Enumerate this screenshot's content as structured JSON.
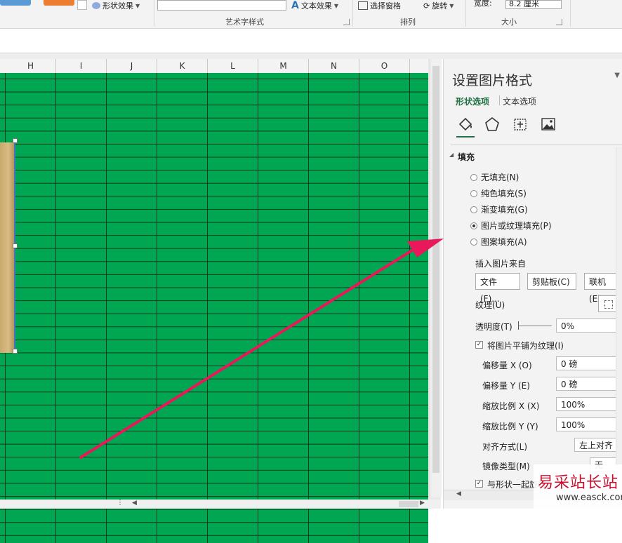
{
  "ribbon": {
    "shape_effect": "形状效果",
    "text_effect": "文本效果",
    "select_pane": "选择窗格",
    "rotate": "旋转",
    "width_label": "宽度:",
    "width_value": "8.2 厘米",
    "group_wordart": "艺术字样式",
    "group_arrange": "排列",
    "group_size": "大小"
  },
  "columns": [
    "H",
    "I",
    "J",
    "K",
    "L",
    "M",
    "N",
    "O"
  ],
  "pane": {
    "title": "设置图片格式",
    "tab_shape": "形状选项",
    "tab_text": "文本选项",
    "section_fill": "填充",
    "fill_options": [
      {
        "label": "无填充(N)",
        "selected": false
      },
      {
        "label": "纯色填充(S)",
        "selected": false
      },
      {
        "label": "渐变填充(G)",
        "selected": false
      },
      {
        "label": "图片或纹理填充(P)",
        "selected": true
      },
      {
        "label": "图案填充(A)",
        "selected": false
      }
    ],
    "insert_from": "插入图片来自",
    "btn_file": "文件(F)...",
    "btn_clipboard": "剪贴板(C)",
    "btn_online": "联机(E)...",
    "texture_label": "纹理(U)",
    "transparency_label": "透明度(T)",
    "transparency_value": "0%",
    "tile_label": "将图片平铺为纹理(I)",
    "tile_checked": true,
    "offset_x_label": "偏移量 X (O)",
    "offset_x_value": "0 磅",
    "offset_y_label": "偏移量 Y (E)",
    "offset_y_value": "0 磅",
    "scale_x_label": "缩放比例 X (X)",
    "scale_x_value": "100%",
    "scale_y_label": "缩放比例 Y (Y)",
    "scale_y_value": "100%",
    "align_label": "对齐方式(L)",
    "align_value": "左上对齐",
    "mirror_label": "镜像类型(M)",
    "mirror_value": "无",
    "rotate_with_label": "与形状一起旋转"
  },
  "watermark": {
    "brand": "易采站长站",
    "url": "www.easck.com"
  },
  "colors": {
    "sheet_fill": "#00a651",
    "accent": "#217346",
    "arrow": "#e8185a"
  }
}
